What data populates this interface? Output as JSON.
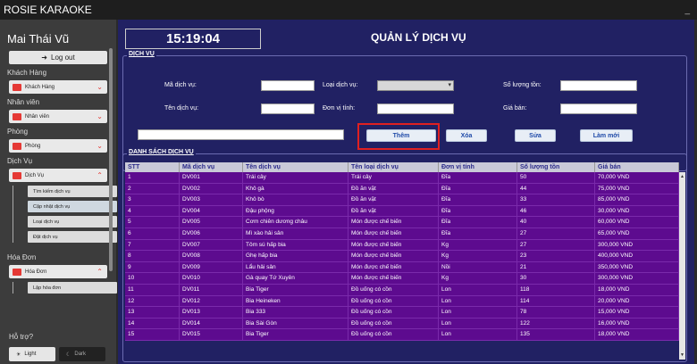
{
  "app": {
    "title": "ROSIE KARAOKE",
    "min": "_"
  },
  "sidebar": {
    "user": "Mai Thái Vũ",
    "logout": "Log out",
    "sections": [
      {
        "title": "Khách Hàng",
        "item": "Khách Hàng"
      },
      {
        "title": "Nhân viên",
        "item": "Nhân viên"
      },
      {
        "title": "Phòng",
        "item": "Phòng"
      },
      {
        "title": "Dịch Vụ",
        "item": "Dịch Vụ"
      }
    ],
    "dv_sub": [
      "Tìm kiếm dịch vụ",
      "Cập nhật dịch vụ",
      "Loại dịch vụ",
      "Đặt dịch vụ"
    ],
    "hd_title": "Hóa Đơn",
    "hd_item": "Hóa Đơn",
    "hd_sub": [
      "Lập hóa đơn"
    ],
    "help": "Hỗ trợ?",
    "light": "Light",
    "dark": "Dark"
  },
  "main": {
    "clock": "15:19:04",
    "heading": "QUẢN LÝ DỊCH VỤ",
    "form_legend": "DỊCH VỤ",
    "labels": {
      "ma": "Mã dịch vụ:",
      "loai": "Loại dịch vụ:",
      "soluong": "Số lượng tồn:",
      "ten": "Tên dịch vụ:",
      "donvi": "Đơn vị tính:",
      "gia": "Giá bán:"
    },
    "buttons": {
      "them": "Thêm",
      "xoa": "Xóa",
      "sua": "Sửa",
      "lammoi": "Làm mới"
    },
    "table_legend": "DANH SÁCH DỊCH VỤ",
    "columns": [
      "STT",
      "Mã dịch vụ",
      "Tên dịch vụ",
      "Tên loại dịch vụ",
      "Đơn vị tính",
      "Số lượng tồn",
      "Giá bán"
    ],
    "rows": [
      [
        "1",
        "DV001",
        "Trái cây",
        "Trái cây",
        "Đĩa",
        "50",
        "70,000 VND"
      ],
      [
        "2",
        "DV002",
        "Khô gà",
        "Đồ ăn vặt",
        "Đĩa",
        "44",
        "75,000 VND"
      ],
      [
        "3",
        "DV003",
        "Khô bò",
        "Đồ ăn vặt",
        "Đĩa",
        "33",
        "85,000 VND"
      ],
      [
        "4",
        "DV004",
        "Đậu phộng",
        "Đồ ăn vặt",
        "Đĩa",
        "46",
        "30,000 VND"
      ],
      [
        "5",
        "DV005",
        "Cơm chiên dương châu",
        "Món được chế biến",
        "Đĩa",
        "40",
        "60,000 VND"
      ],
      [
        "6",
        "DV006",
        "Mì xào hải sản",
        "Món được chế biến",
        "Đĩa",
        "27",
        "65,000 VND"
      ],
      [
        "7",
        "DV007",
        "Tôm sú hấp bia",
        "Món được chế biến",
        "Kg",
        "27",
        "300,000 VND"
      ],
      [
        "8",
        "DV008",
        "Ghẹ hấp bia",
        "Món được chế biến",
        "Kg",
        "23",
        "400,000 VND"
      ],
      [
        "9",
        "DV009",
        "Lẩu hải sản",
        "Món được chế biến",
        "Nồi",
        "21",
        "350,000 VND"
      ],
      [
        "10",
        "DV010",
        "Gà quay Tứ Xuyên",
        "Món được chế biến",
        "Kg",
        "30",
        "300,000 VND"
      ],
      [
        "11",
        "DV011",
        "Bia Tiger",
        "Đồ uống có cồn",
        "Lon",
        "118",
        "18,000 VND"
      ],
      [
        "12",
        "DV012",
        "Bia Heineken",
        "Đồ uống có cồn",
        "Lon",
        "114",
        "20,000 VND"
      ],
      [
        "13",
        "DV013",
        "Bia 333",
        "Đồ uống có cồn",
        "Lon",
        "78",
        "15,000 VND"
      ],
      [
        "14",
        "DV014",
        "Bia Sài Gòn",
        "Đồ uống có cồn",
        "Lon",
        "122",
        "16,000 VND"
      ],
      [
        "15",
        "DV015",
        "Bia Tiger",
        "Đồ uống có cồn",
        "Lon",
        "135",
        "18,000 VND"
      ]
    ]
  }
}
